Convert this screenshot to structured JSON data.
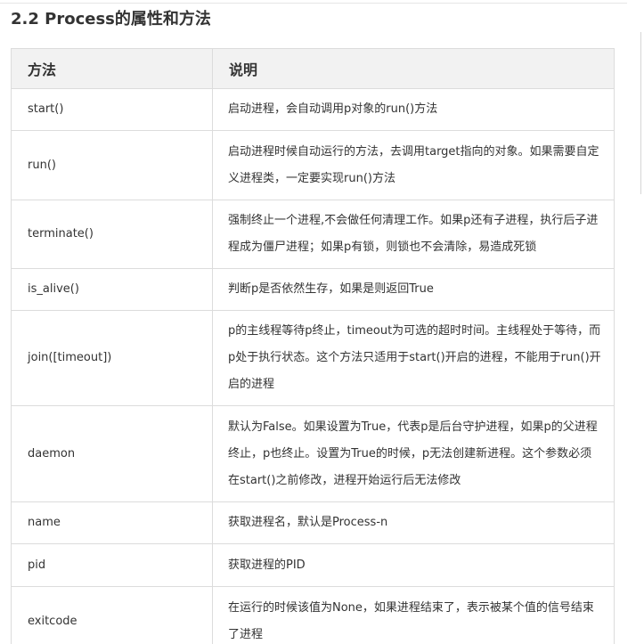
{
  "heading": "2.2 Process的属性和方法",
  "table": {
    "headers": [
      "方法",
      "说明"
    ],
    "rows": [
      {
        "name": "start()",
        "desc": "启动进程，会自动调用p对象的run()方法"
      },
      {
        "name": "run()",
        "desc": "启动进程时候自动运行的方法，去调用target指向的对象。如果需要自定义进程类，一定要实现run()方法"
      },
      {
        "name": "terminate()",
        "desc": "强制终止一个进程,不会做任何清理工作。如果p还有子进程，执行后子进程成为僵尸进程；如果p有锁，则锁也不会清除，易造成死锁"
      },
      {
        "name": "is_alive()",
        "desc": "判断p是否依然生存，如果是则返回True"
      },
      {
        "name": "join([timeout])",
        "desc": "p的主线程等待p终止，timeout为可选的超时时间。主线程处于等待，而p处于执行状态。这个方法只适用于start()开启的进程，不能用于run()开启的进程"
      },
      {
        "name": "daemon",
        "desc": "默认为False。如果设置为True，代表p是后台守护进程，如果p的父进程终止，p也终止。设置为True的时候，p无法创建新进程。这个参数必须在start()之前修改，进程开始运行后无法修改"
      },
      {
        "name": "name",
        "desc": "获取进程名，默认是Process-n"
      },
      {
        "name": "pid",
        "desc": "获取进程的PID"
      },
      {
        "name": "exitcode",
        "desc": "在运行的时候该值为None，如果进程结束了，表示被某个值的信号结束了进程"
      }
    ]
  }
}
